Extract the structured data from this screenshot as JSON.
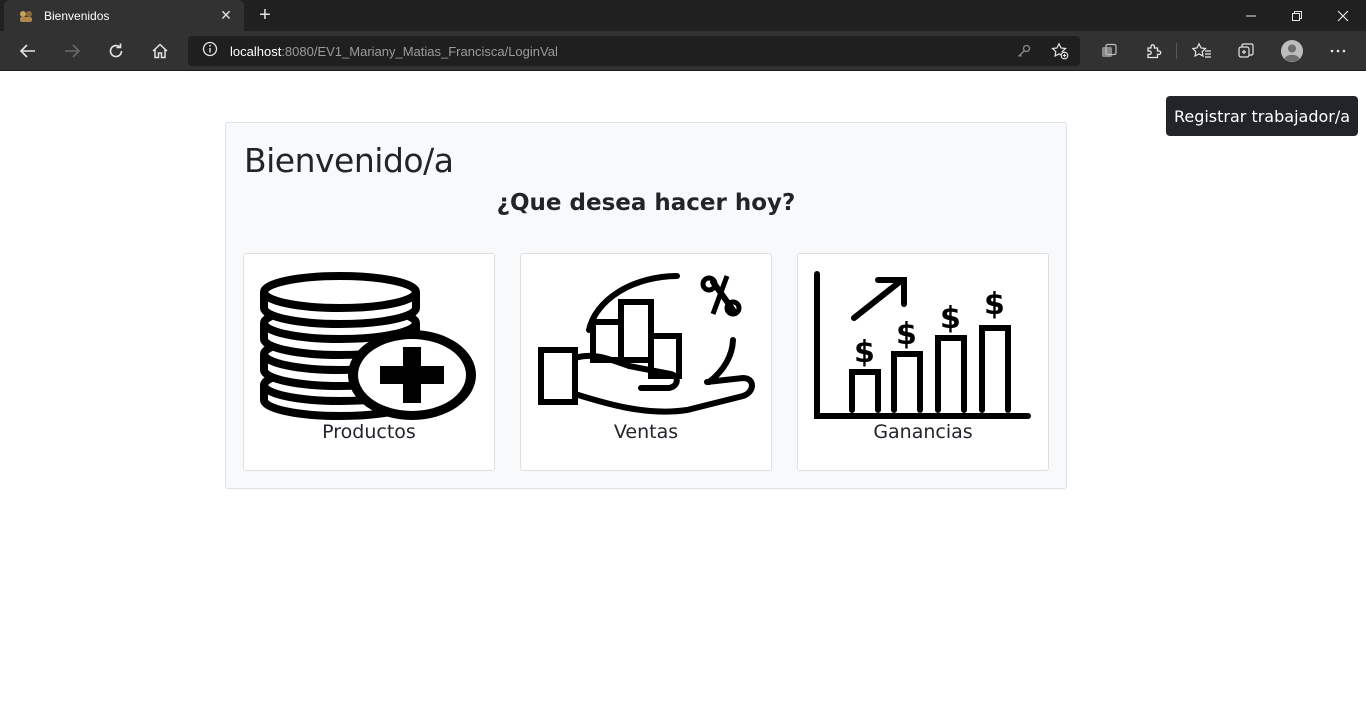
{
  "browser": {
    "tab_title": "Bienvenidos",
    "new_tab_label": "+",
    "url_host": "localhost",
    "url_rest": ":8080/EV1_Mariany_Matias_Francisca/LoginVal"
  },
  "page": {
    "register_button": "Registrar trabajador/a",
    "welcome_title": "Bienvenido/a",
    "question": "¿Que desea hacer hoy?",
    "cards": [
      {
        "label": "Productos",
        "icon": "database-plus-icon"
      },
      {
        "label": "Ventas",
        "icon": "hand-sales-chart-icon"
      },
      {
        "label": "Ganancias",
        "icon": "profit-growth-chart-icon"
      }
    ]
  },
  "colors": {
    "dark_button": "#212529",
    "panel_bg": "#f8f9fa",
    "chrome_bg": "#202020",
    "toolbar_bg": "#323232"
  }
}
